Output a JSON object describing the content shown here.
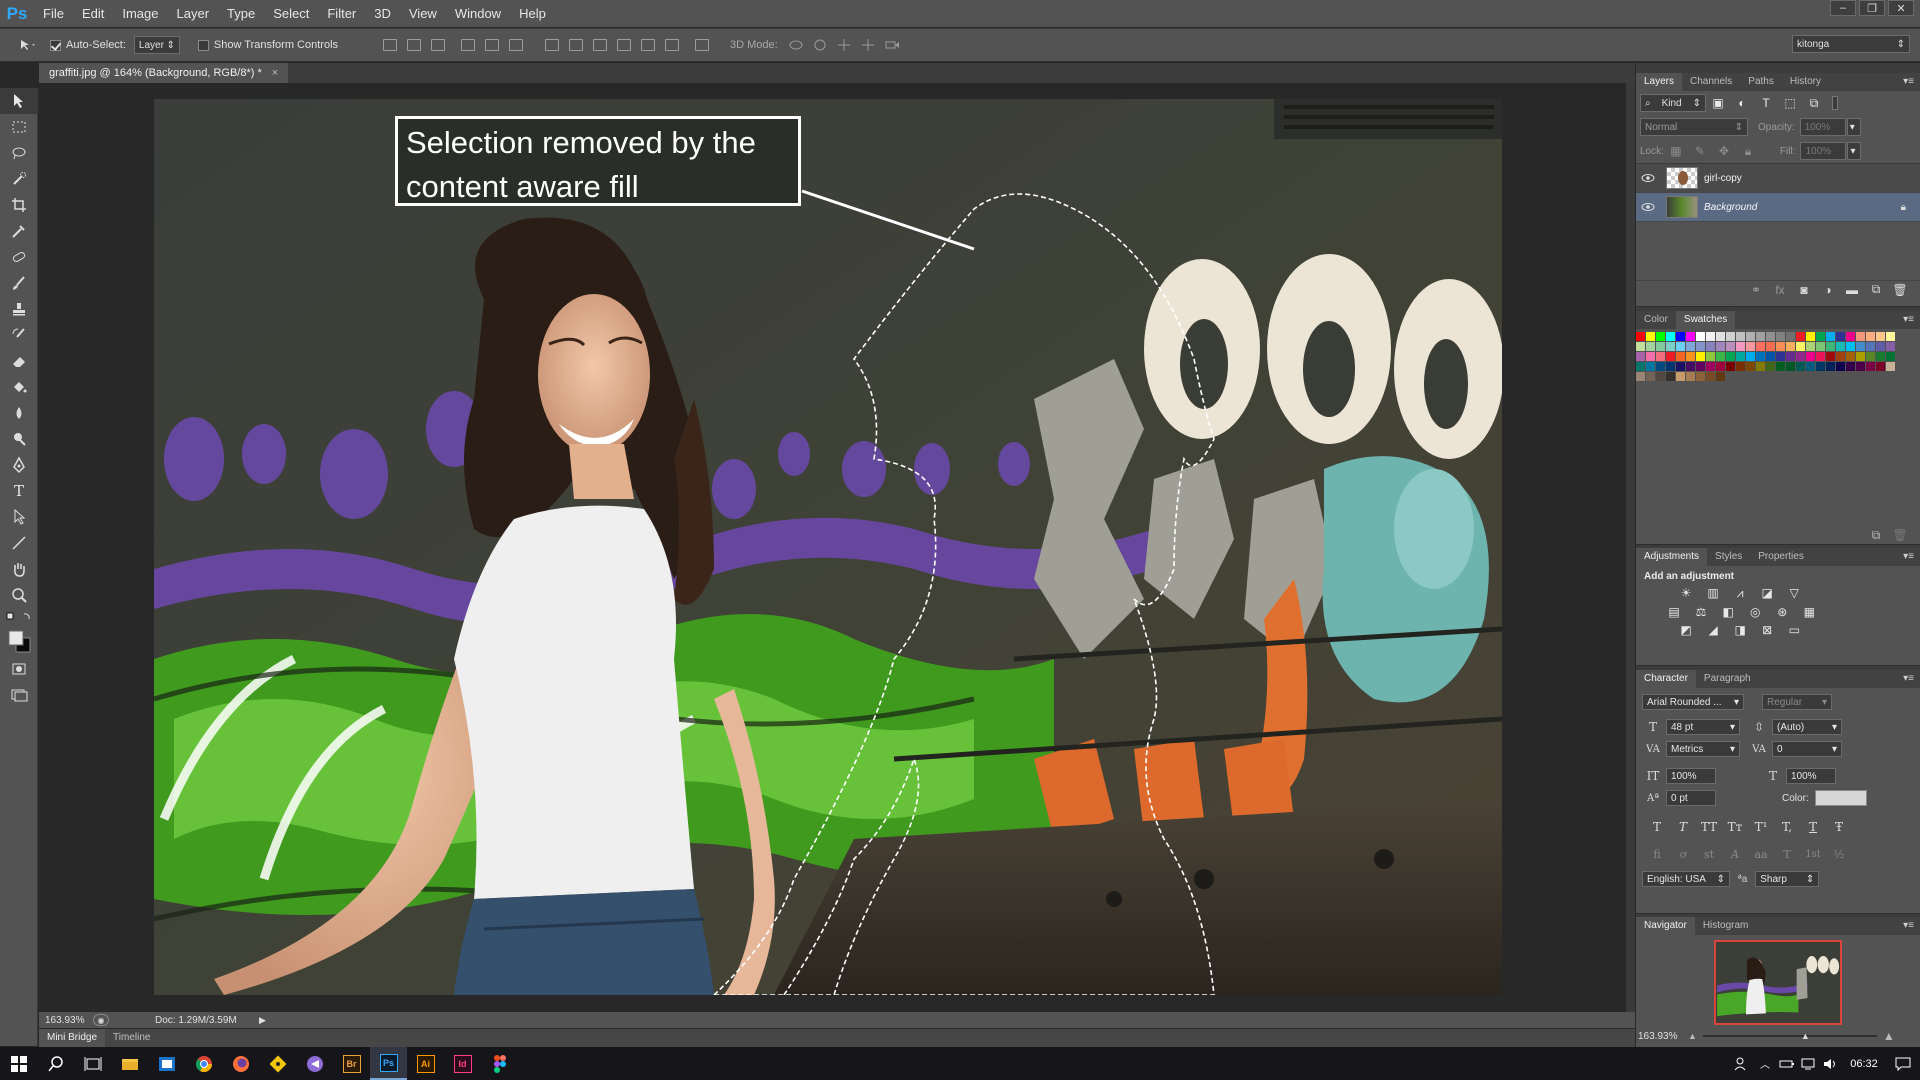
{
  "app": {
    "logo": "Ps"
  },
  "menu": [
    "File",
    "Edit",
    "Image",
    "Layer",
    "Type",
    "Select",
    "Filter",
    "3D",
    "View",
    "Window",
    "Help"
  ],
  "window_controls": [
    "–",
    "❐",
    "✕"
  ],
  "options": {
    "auto_select_label": "Auto-Select:",
    "auto_select_checked": true,
    "auto_select_target": "Layer",
    "show_transform_label": "Show Transform Controls",
    "mode_label": "3D Mode:",
    "workspace": "kitonga"
  },
  "document": {
    "tab_title": "graffiti.jpg @ 164% (Background, RGB/8*) *",
    "tab_close": "×",
    "zoom": "163.93%",
    "doc_size": "Doc: 1.29M/3.59M"
  },
  "annotation": {
    "callout_text": "Selection removed by the content aware fill"
  },
  "bottom_tabs": [
    "Mini Bridge",
    "Timeline"
  ],
  "layers_panel": {
    "tabs": [
      "Layers",
      "Channels",
      "Paths",
      "History"
    ],
    "filter_kind": "Kind",
    "blend_mode": "Normal",
    "opacity_label": "Opacity:",
    "opacity_value": "100%",
    "lock_label": "Lock:",
    "fill_label": "Fill:",
    "fill_value": "100%",
    "layers": [
      {
        "name": "girl-copy",
        "visible": true,
        "selected": false,
        "locked": false
      },
      {
        "name": "Background",
        "visible": true,
        "selected": true,
        "locked": true
      }
    ]
  },
  "swatches_panel": {
    "tabs": [
      "Color",
      "Swatches"
    ],
    "colors": [
      "#ff0000",
      "#ffff00",
      "#00ff00",
      "#00ffff",
      "#0000ff",
      "#ff00ff",
      "#ffffff",
      "#f0f0f0",
      "#e0e0e0",
      "#d0d0d0",
      "#c0c0c0",
      "#b0b0b0",
      "#a0a0a0",
      "#909090",
      "#808080",
      "#707070",
      "#ee1d24",
      "#fff200",
      "#00a651",
      "#00aeef",
      "#2e3192",
      "#ec008c",
      "#f7977a",
      "#f9ad81",
      "#fdc68a",
      "#fff79a",
      "#c4df9b",
      "#a2d39c",
      "#82ca9d",
      "#7bcdc8",
      "#6ecff6",
      "#7ea7d8",
      "#8493ca",
      "#8882be",
      "#a187be",
      "#bc8dbf",
      "#f49ac2",
      "#f6989d",
      "#ff6f61",
      "#f26c4f",
      "#f68e55",
      "#fbaf5c",
      "#fff467",
      "#acd372",
      "#7cc576",
      "#3bb878",
      "#1abbb4",
      "#00bff3",
      "#438ccb",
      "#5574b9",
      "#605ca8",
      "#855fa8",
      "#a763a8",
      "#f06ea9",
      "#f26d7d",
      "#ed1c24",
      "#f26522",
      "#f7941d",
      "#fff200",
      "#8dc73f",
      "#39b54a",
      "#00a651",
      "#00a99d",
      "#00aeef",
      "#0072bc",
      "#0054a6",
      "#2e3192",
      "#662d91",
      "#92278f",
      "#ec008c",
      "#ed145b",
      "#9e0b0f",
      "#a0410d",
      "#a36209",
      "#aba000",
      "#598527",
      "#197b30",
      "#007236",
      "#00746b",
      "#0076a3",
      "#004b80",
      "#003471",
      "#1b1464",
      "#440e62",
      "#630460",
      "#9e005d",
      "#9e0039",
      "#790000",
      "#7b2e00",
      "#7d4900",
      "#827b00",
      "#406618",
      "#005e20",
      "#005826",
      "#005952",
      "#005b7f",
      "#003663",
      "#002157",
      "#0d004c",
      "#32004b",
      "#4b0049",
      "#7b0046",
      "#7a0026",
      "#c7b299",
      "#998675",
      "#736357",
      "#534741",
      "#37302a",
      "#c69c6d",
      "#a67c52",
      "#8c6239",
      "#754c24",
      "#603913"
    ]
  },
  "adjustments_panel": {
    "tabs": [
      "Adjustments",
      "Styles",
      "Properties"
    ],
    "heading": "Add an adjustment",
    "icons": [
      "brightness-icon",
      "levels-icon",
      "curves-icon",
      "exposure-icon",
      "vibrance-icon",
      "hue-saturation-icon",
      "color-balance-icon",
      "black-white-icon",
      "photo-filter-icon",
      "channel-mixer-icon",
      "color-lookup-icon",
      "invert-icon",
      "posterize-icon",
      "threshold-icon",
      "selective-color-icon",
      "gradient-map-icon"
    ]
  },
  "character_panel": {
    "tabs": [
      "Character",
      "Paragraph"
    ],
    "font_family": "Arial Rounded ...",
    "font_style": "Regular",
    "font_size": "48 pt",
    "leading": "(Auto)",
    "kerning": "Metrics",
    "tracking": "0",
    "vertical_scale": "100%",
    "horizontal_scale": "100%",
    "baseline_shift": "0 pt",
    "color_label": "Color:",
    "style_buttons": [
      "T",
      "T",
      "TT",
      "Tт",
      "T¹",
      "T,",
      "T",
      "Ŧ"
    ],
    "opentype_buttons": [
      "fi",
      "ơ",
      "st",
      "A",
      "aa",
      "T",
      "1st",
      "½"
    ],
    "language": "English: USA",
    "aa_label": "a",
    "antialias": "Sharp"
  },
  "navigator_panel": {
    "tabs": [
      "Navigator",
      "Histogram"
    ],
    "zoom": "163.93%"
  },
  "taskbar": {
    "time": "06:32",
    "apps": [
      "start",
      "search",
      "task-view",
      "file-explorer",
      "outlook",
      "chrome",
      "firefox",
      "git",
      "visual-studio",
      "bridge",
      "photoshop",
      "illustrator",
      "indesign",
      "figma"
    ],
    "app_labels": {
      "bridge": "Br",
      "photoshop": "Ps",
      "illustrator": "Ai",
      "indesign": "Id"
    }
  },
  "colors": {
    "panel_bg": "#535353",
    "dark_bg": "#282828",
    "ps_blue": "#31a8ff",
    "selected_layer": "#5a6a82"
  }
}
